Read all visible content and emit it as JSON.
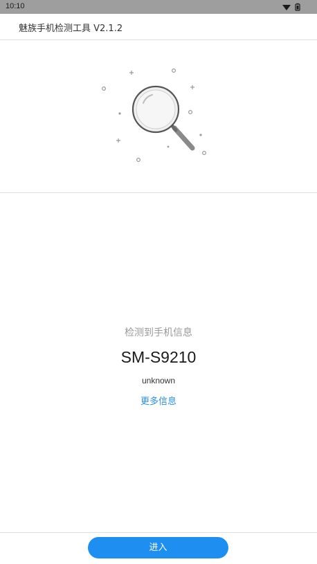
{
  "status_bar": {
    "time": "10:10",
    "icons": [
      "wifi-icon",
      "battery-icon"
    ]
  },
  "header": {
    "title": "魅族手机检测工具 V2.1.2"
  },
  "illustration": {
    "icon": "magnifier-icon"
  },
  "info": {
    "label": "检测到手机信息",
    "model": "SM-S9210",
    "sub": "unknown",
    "more_link": "更多信息"
  },
  "footer": {
    "enter_label": "进入"
  },
  "colors": {
    "accent": "#1e8ff0",
    "link": "#2a8de8",
    "status_bar": "#9e9e9e"
  }
}
